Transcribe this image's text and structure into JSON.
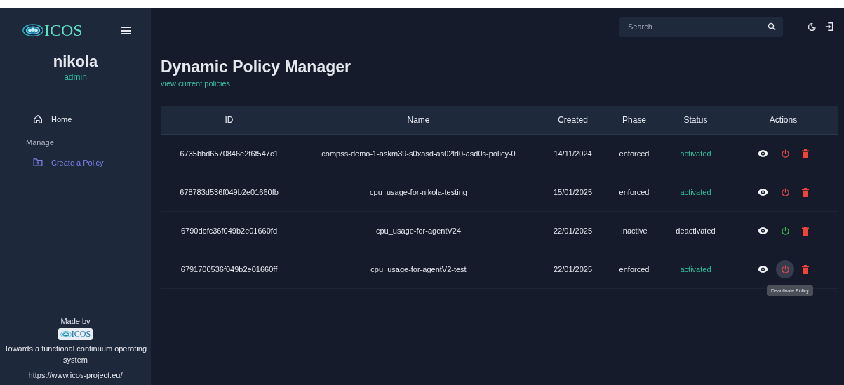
{
  "sidebar": {
    "logo_text": "ICOS",
    "user": {
      "name": "nikola",
      "role": "admin"
    },
    "items": [
      {
        "kind": "link",
        "label": "Home",
        "selected": false
      },
      {
        "kind": "section",
        "label": "Manage"
      },
      {
        "kind": "link",
        "label": "Create a Policy",
        "selected": true
      }
    ],
    "footer": {
      "made_by": "Made by",
      "logo_text": "ICOS",
      "tagline": "Towards a functional continuum operating system",
      "link": "https://www.icos-project.eu/"
    }
  },
  "topbar": {
    "search": {
      "placeholder": "Search"
    }
  },
  "page": {
    "title": "Dynamic Policy Manager",
    "subtitle": "view current policies"
  },
  "table": {
    "columns": [
      "ID",
      "Name",
      "Created",
      "Phase",
      "Status",
      "Actions"
    ],
    "rows": [
      {
        "id": "6735bbd6570846e2f6f547c1",
        "name": "compss-demo-1-askm39-s0xasd-as02ld0-asd0s-policy-0",
        "created": "14/11/2024",
        "phase": "enforced",
        "status": "activated",
        "active": true,
        "hovered": false
      },
      {
        "id": "678783d536f049b2e01660fb",
        "name": "cpu_usage-for-nikola-testing",
        "created": "15/01/2025",
        "phase": "enforced",
        "status": "activated",
        "active": true,
        "hovered": false
      },
      {
        "id": "6790dbfc36f049b2e01660fd",
        "name": "cpu_usage-for-agentV24",
        "created": "22/01/2025",
        "phase": "inactive",
        "status": "deactivated",
        "active": false,
        "hovered": false
      },
      {
        "id": "6791700536f049b2e01660ff",
        "name": "cpu_usage-for-agentV2-test",
        "created": "22/01/2025",
        "phase": "enforced",
        "status": "activated",
        "active": true,
        "hovered": true
      }
    ]
  },
  "tooltip": {
    "text": "Deactivate Policy"
  }
}
